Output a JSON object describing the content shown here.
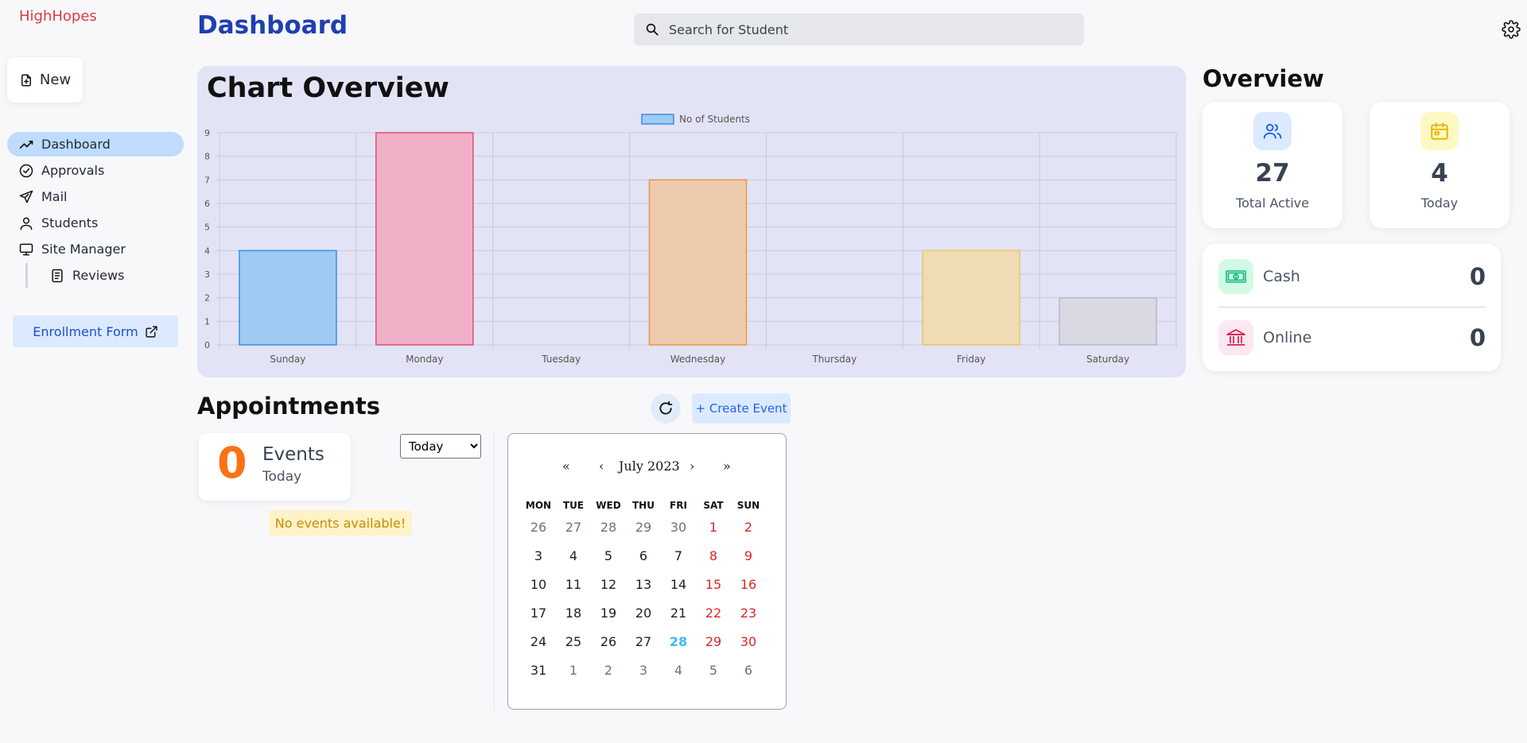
{
  "app": {
    "brand": "HighHopes"
  },
  "sidebar": {
    "new_label": "New",
    "items": [
      {
        "label": "Dashboard",
        "icon": "trend-icon"
      },
      {
        "label": "Approvals",
        "icon": "check-circle-icon"
      },
      {
        "label": "Mail",
        "icon": "send-icon"
      },
      {
        "label": "Students",
        "icon": "user-icon"
      },
      {
        "label": "Site Manager",
        "icon": "monitor-icon"
      }
    ],
    "sub_items": [
      {
        "label": "Reviews",
        "icon": "document-icon"
      }
    ],
    "enrollment_label": "Enrollment Form"
  },
  "header": {
    "title": "Dashboard",
    "search_placeholder": "Search for Student"
  },
  "chart_data": {
    "type": "bar",
    "title": "Chart Overview",
    "categories": [
      "Sunday",
      "Monday",
      "Tuesday",
      "Wednesday",
      "Thursday",
      "Friday",
      "Saturday"
    ],
    "series": [
      {
        "name": "No of Students",
        "values": [
          4,
          9,
          0,
          7,
          0,
          4,
          2
        ]
      }
    ],
    "ylim": [
      0,
      9
    ],
    "yticks": [
      0,
      1,
      2,
      3,
      4,
      5,
      6,
      7,
      8,
      9
    ],
    "colors": [
      "#9fcaf2",
      "#efb0c8",
      "#b7e3d3",
      "#efcbae",
      "#d8ccf5",
      "#efdcb4",
      "#d8d9e3"
    ],
    "borders": [
      "#3b8ee6",
      "#e0506f",
      "#4fb38b",
      "#e9963f",
      "#8a6cd8",
      "#e9c36a",
      "#b6b8c4"
    ],
    "legend_color": "#9fcaf2",
    "legend_border": "#3b8ee6",
    "legend": "top-center",
    "grid": true
  },
  "overview": {
    "title": "Overview",
    "total_active": {
      "value": "27",
      "label": "Total Active",
      "icon": "users-icon"
    },
    "today": {
      "value": "4",
      "label": "Today",
      "icon": "calendar-icon"
    },
    "cash": {
      "label": "Cash",
      "value": "0",
      "icon": "cash-icon"
    },
    "online": {
      "label": "Online",
      "value": "0",
      "icon": "bank-icon"
    }
  },
  "appointments": {
    "title": "Appointments",
    "create_label": "+ Create Event",
    "events_count": "0",
    "events_label": "Events",
    "events_sub": "Today",
    "range_options": [
      "Today"
    ],
    "range_selected": "Today",
    "empty_message": "No events available!"
  },
  "calendar": {
    "month_label": "July 2023",
    "nav": {
      "prev_year": "«",
      "prev_month": "‹",
      "next_month": "›",
      "next_year": "»"
    },
    "weekdays": [
      "MON",
      "TUE",
      "WED",
      "THU",
      "FRI",
      "SAT",
      "SUN"
    ],
    "weeks": [
      [
        "26",
        "27",
        "28",
        "29",
        "30",
        "1",
        "2"
      ],
      [
        "3",
        "4",
        "5",
        "6",
        "7",
        "8",
        "9"
      ],
      [
        "10",
        "11",
        "12",
        "13",
        "14",
        "15",
        "16"
      ],
      [
        "17",
        "18",
        "19",
        "20",
        "21",
        "22",
        "23"
      ],
      [
        "24",
        "25",
        "26",
        "27",
        "28",
        "29",
        "30"
      ],
      [
        "31",
        "1",
        "2",
        "3",
        "4",
        "5",
        "6"
      ]
    ],
    "today": "28"
  }
}
